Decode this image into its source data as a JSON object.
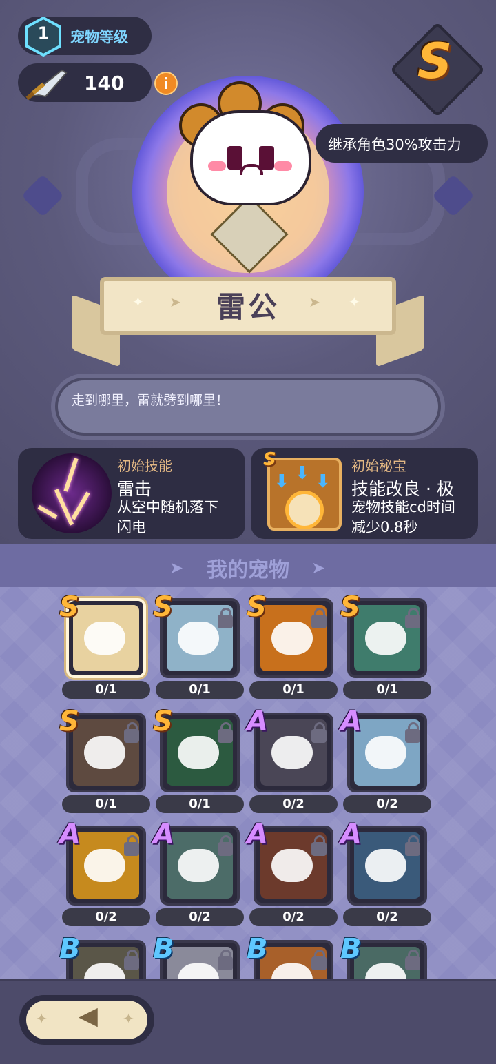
{
  "header": {
    "pet_level_label": "宠物等级",
    "pet_level": "1",
    "power_value": "140",
    "info_icon": "i",
    "rank": "S",
    "inherit_text": "继承角色30%攻击力"
  },
  "pet": {
    "name": "雷公",
    "description": "走到哪里，雷就劈到哪里！"
  },
  "skill_card": {
    "title": "初始技能",
    "name": "雷击",
    "desc_line1": "从空中随机落下",
    "desc_line2": "闪电"
  },
  "treasure_card": {
    "rank": "S",
    "title": "初始秘宝",
    "name": "技能改良 · 极",
    "desc_line1": "宠物技能cd时间",
    "desc_line2": "减少0.8秒"
  },
  "my_pets": {
    "title": "我的宠物",
    "items": [
      {
        "rank": "S",
        "count": "0/1",
        "color": "#e8d2a0",
        "locked": false,
        "selected": true
      },
      {
        "rank": "S",
        "count": "0/1",
        "color": "#8fb2c8",
        "locked": true,
        "selected": false
      },
      {
        "rank": "S",
        "count": "0/1",
        "color": "#c8701c",
        "locked": true,
        "selected": false
      },
      {
        "rank": "S",
        "count": "0/1",
        "color": "#3f7c6c",
        "locked": true,
        "selected": false
      },
      {
        "rank": "S",
        "count": "0/1",
        "color": "#5e4a40",
        "locked": true,
        "selected": false
      },
      {
        "rank": "S",
        "count": "0/1",
        "color": "#2c5a40",
        "locked": true,
        "selected": false
      },
      {
        "rank": "A",
        "count": "0/2",
        "color": "#4a4656",
        "locked": true,
        "selected": false
      },
      {
        "rank": "A",
        "count": "0/2",
        "color": "#7ea6c4",
        "locked": true,
        "selected": false
      },
      {
        "rank": "A",
        "count": "0/2",
        "color": "#c68a1e",
        "locked": true,
        "selected": false
      },
      {
        "rank": "A",
        "count": "0/2",
        "color": "#4c6c68",
        "locked": true,
        "selected": false
      },
      {
        "rank": "A",
        "count": "0/2",
        "color": "#6c3a2c",
        "locked": true,
        "selected": false
      },
      {
        "rank": "A",
        "count": "0/2",
        "color": "#3a5a7a",
        "locked": true,
        "selected": false
      },
      {
        "rank": "B",
        "count": "",
        "color": "#5a5648",
        "locked": true,
        "selected": false
      },
      {
        "rank": "B",
        "count": "",
        "color": "#8a8a9a",
        "locked": true,
        "selected": false
      },
      {
        "rank": "B",
        "count": "",
        "color": "#a8602a",
        "locked": true,
        "selected": false
      },
      {
        "rank": "B",
        "count": "",
        "color": "#4a6a64",
        "locked": true,
        "selected": false
      }
    ]
  },
  "bottom": {
    "back_icon": "back-arrow-icon"
  }
}
